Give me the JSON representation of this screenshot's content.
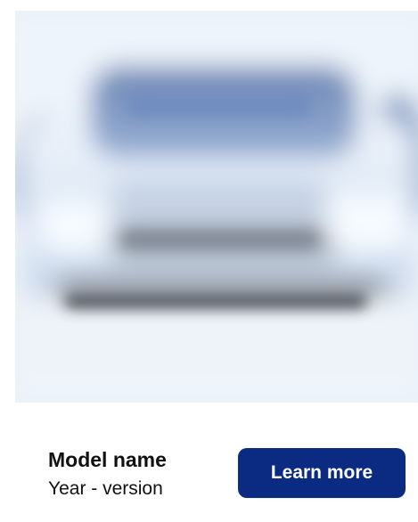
{
  "card": {
    "image": {
      "subject": "blurred-vehicle-image"
    },
    "title": "Model name",
    "subtitle": "Year - version",
    "cta_label": "Learn more"
  },
  "colors": {
    "button": "#0b2a82",
    "button_text": "#ffffff",
    "text": "#111111",
    "background": "#ffffff",
    "image_tint": "#eaf1f9"
  }
}
